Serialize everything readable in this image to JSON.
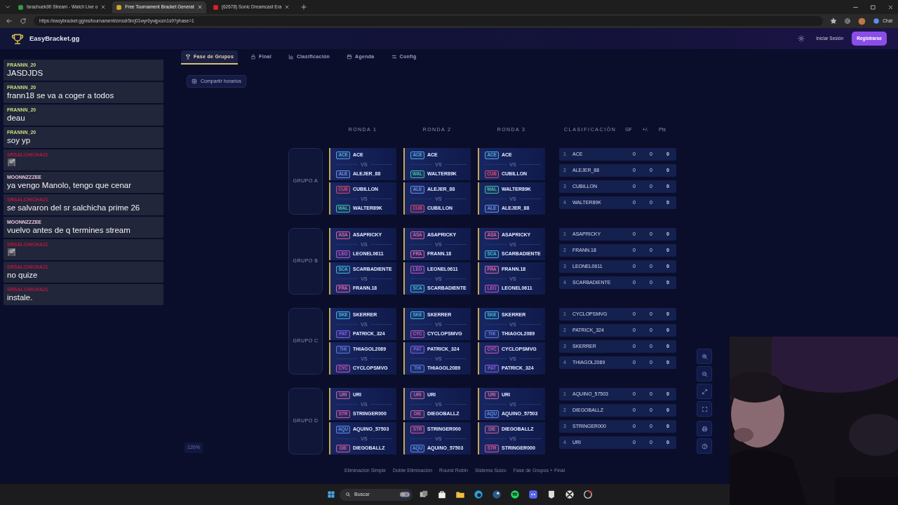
{
  "browser": {
    "tabs": [
      {
        "title": "Israchuek90 Stream - Watch Live o",
        "selected": false
      },
      {
        "title": "Free Tournament Bracket Generat",
        "selected": true
      },
      {
        "title": "(62678) Sonic Dreamcast Era",
        "selected": false
      }
    ],
    "url": "https://easybracket.gg/es/tournament/cmsdr5mj01wyr6ywjpozn1s9?phase=1",
    "chat_button": "Chat"
  },
  "app": {
    "brand": "EasyBracket.gg",
    "login": "Iniciar Sesión",
    "register": "Registrarse"
  },
  "chat": [
    {
      "user": "FRANNN_20",
      "color": "#c9dc82",
      "kind": "text",
      "message": "JASDJDS"
    },
    {
      "user": "FRANNN_20",
      "color": "#c9dc82",
      "kind": "text",
      "message": "frann18 se va a coger a todos"
    },
    {
      "user": "FRANNN_20",
      "color": "#c9dc82",
      "kind": "text",
      "message": "deau"
    },
    {
      "user": "FRANNN_20",
      "color": "#c9dc82",
      "kind": "text",
      "message": "soy yp"
    },
    {
      "user": "SRSALCHICHA21",
      "color": "#b8163e",
      "kind": "emote"
    },
    {
      "user": "MOONNZZZEE",
      "color": "#e8c6de",
      "kind": "text",
      "message": "ya vengo Manolo, tengo que cenar"
    },
    {
      "user": "SRSALCHICHA21",
      "color": "#b8163e",
      "kind": "text",
      "message": "se salvaron del sr salchicha prime 26"
    },
    {
      "user": "MOONNZZZEE",
      "color": "#e8c6de",
      "kind": "text",
      "message": "vuelvo antes de q termines stream"
    },
    {
      "user": "SRSALCHICHA21",
      "color": "#b8163e",
      "kind": "emote"
    },
    {
      "user": "SRSALCHICHA21",
      "color": "#b8163e",
      "kind": "text",
      "message": "no quize"
    },
    {
      "user": "SRSALCHICHA21",
      "color": "#b8163e",
      "kind": "text",
      "message": "instale."
    }
  ],
  "tabs": [
    {
      "label": "Fase de Grupos",
      "selected": true
    },
    {
      "label": "Final",
      "selected": false
    },
    {
      "label": "Clasificación",
      "selected": false
    },
    {
      "label": "Agenda",
      "selected": false
    },
    {
      "label": "Config",
      "selected": false
    }
  ],
  "share_button": "Compartir horarios",
  "round_headers": [
    "RONDA 1",
    "RONDA 2",
    "RONDA 3"
  ],
  "standings_headers": [
    "CLASIFICACIÓN",
    "GF",
    "+/-",
    "Pts"
  ],
  "groups": [
    {
      "label": "GRUPO A",
      "rounds": [
        [
          {
            "a": {
              "tag": "ACE",
              "name": "ACE",
              "color": "#4aa8e8"
            },
            "vs": "VS",
            "b": {
              "tag": "ALE",
              "name": "ALEJER_88",
              "color": "#6a8ee8"
            }
          },
          {
            "a": {
              "tag": "CUB",
              "name": "CUBILLON",
              "color": "#e0406a"
            },
            "vs": "VS",
            "b": {
              "tag": "WAL",
              "name": "WALTER89K",
              "color": "#3cc0a0"
            }
          }
        ],
        [
          {
            "a": {
              "tag": "ACE",
              "name": "ACE",
              "color": "#4aa8e8"
            },
            "vs": "VS",
            "b": {
              "tag": "WAL",
              "name": "WALTER89K",
              "color": "#3cc0a0"
            }
          },
          {
            "a": {
              "tag": "ALE",
              "name": "ALEJER_88",
              "color": "#6a8ee8"
            },
            "vs": "VS",
            "b": {
              "tag": "CUB",
              "name": "CUBILLON",
              "color": "#e0406a"
            }
          }
        ],
        [
          {
            "a": {
              "tag": "ACE",
              "name": "ACE",
              "color": "#4aa8e8"
            },
            "vs": "VS",
            "b": {
              "tag": "CUB",
              "name": "CUBILLON",
              "color": "#e0406a"
            }
          },
          {
            "a": {
              "tag": "WAL",
              "name": "WALTER89K",
              "color": "#3cc0a0"
            },
            "vs": "VS",
            "b": {
              "tag": "ALE",
              "name": "ALEJER_88",
              "color": "#6a8ee8"
            }
          }
        ]
      ],
      "standings": [
        {
          "rank": "1",
          "name": "ACE",
          "gf": "0",
          "diff": "0",
          "pts": "0"
        },
        {
          "rank": "2",
          "name": "ALEJER_88",
          "gf": "0",
          "diff": "0",
          "pts": "0"
        },
        {
          "rank": "3",
          "name": "CUBILLON",
          "gf": "0",
          "diff": "0",
          "pts": "0"
        },
        {
          "rank": "4",
          "name": "WALTER89K",
          "gf": "0",
          "diff": "0",
          "pts": "0"
        }
      ]
    },
    {
      "label": "GRUPO B",
      "rounds": [
        [
          {
            "a": {
              "tag": "ASA",
              "name": "ASAPRICKY",
              "color": "#e05a9a"
            },
            "vs": "VS",
            "b": {
              "tag": "LEO",
              "name": "LEONEL0611",
              "color": "#c050c8"
            }
          },
          {
            "a": {
              "tag": "SCA",
              "name": "SCARBADIENTE",
              "color": "#3ab8d8"
            },
            "vs": "VS",
            "b": {
              "tag": "FRA",
              "name": "FRANN.18",
              "color": "#e060a8"
            }
          }
        ],
        [
          {
            "a": {
              "tag": "ASA",
              "name": "ASAPRICKY",
              "color": "#e05a9a"
            },
            "vs": "VS",
            "b": {
              "tag": "FRA",
              "name": "FRANN.18",
              "color": "#e060a8"
            }
          },
          {
            "a": {
              "tag": "LEO",
              "name": "LEONEL0611",
              "color": "#c050c8"
            },
            "vs": "VS",
            "b": {
              "tag": "SCA",
              "name": "SCARBADIENTE",
              "color": "#3ab8d8"
            }
          }
        ],
        [
          {
            "a": {
              "tag": "ASA",
              "name": "ASAPRICKY",
              "color": "#e05a9a"
            },
            "vs": "VS",
            "b": {
              "tag": "SCA",
              "name": "SCARBADIENTE",
              "color": "#3ab8d8"
            }
          },
          {
            "a": {
              "tag": "FRA",
              "name": "FRANN.18",
              "color": "#e060a8"
            },
            "vs": "VS",
            "b": {
              "tag": "LEO",
              "name": "LEONEL0611",
              "color": "#c050c8"
            }
          }
        ]
      ],
      "standings": [
        {
          "rank": "1",
          "name": "ASAPRICKY",
          "gf": "0",
          "diff": "0",
          "pts": "0"
        },
        {
          "rank": "2",
          "name": "FRANN.18",
          "gf": "0",
          "diff": "0",
          "pts": "0"
        },
        {
          "rank": "3",
          "name": "LEONEL0611",
          "gf": "0",
          "diff": "0",
          "pts": "0"
        },
        {
          "rank": "4",
          "name": "SCARBADIENTE",
          "gf": "0",
          "diff": "0",
          "pts": "0"
        }
      ]
    },
    {
      "label": "GRUPO C",
      "rounds": [
        [
          {
            "a": {
              "tag": "SKE",
              "name": "SKERRER",
              "color": "#3ab8e8"
            },
            "vs": "VS",
            "b": {
              "tag": "PAT",
              "name": "PATRICK_324",
              "color": "#8a5ae8"
            }
          },
          {
            "a": {
              "tag": "THI",
              "name": "THIAGOL2089",
              "color": "#5a7ae8"
            },
            "vs": "VS",
            "b": {
              "tag": "CYC",
              "name": "CYCLOPSMVG",
              "color": "#d050c0"
            }
          }
        ],
        [
          {
            "a": {
              "tag": "SKE",
              "name": "SKERRER",
              "color": "#3ab8e8"
            },
            "vs": "VS",
            "b": {
              "tag": "CYC",
              "name": "CYCLOPSMVG",
              "color": "#d050c0"
            }
          },
          {
            "a": {
              "tag": "PAT",
              "name": "PATRICK_324",
              "color": "#8a5ae8"
            },
            "vs": "VS",
            "b": {
              "tag": "THI",
              "name": "THIAGOL2089",
              "color": "#5a7ae8"
            }
          }
        ],
        [
          {
            "a": {
              "tag": "SKE",
              "name": "SKERRER",
              "color": "#3ab8e8"
            },
            "vs": "VS",
            "b": {
              "tag": "THI",
              "name": "THIAGOL2089",
              "color": "#5a7ae8"
            }
          },
          {
            "a": {
              "tag": "CYC",
              "name": "CYCLOPSMVG",
              "color": "#d050c0"
            },
            "vs": "VS",
            "b": {
              "tag": "PAT",
              "name": "PATRICK_324",
              "color": "#8a5ae8"
            }
          }
        ]
      ],
      "standings": [
        {
          "rank": "1",
          "name": "CYCLOPSMVG",
          "gf": "0",
          "diff": "0",
          "pts": "0"
        },
        {
          "rank": "2",
          "name": "PATRICK_324",
          "gf": "0",
          "diff": "0",
          "pts": "0"
        },
        {
          "rank": "3",
          "name": "SKERRER",
          "gf": "0",
          "diff": "0",
          "pts": "0"
        },
        {
          "rank": "4",
          "name": "THIAGOL2089",
          "gf": "0",
          "diff": "0",
          "pts": "0"
        }
      ]
    },
    {
      "label": "GRUPO D",
      "rounds": [
        [
          {
            "a": {
              "tag": "URI",
              "name": "URI",
              "color": "#d060a0"
            },
            "vs": "VS",
            "b": {
              "tag": "STR",
              "name": "STRINGER000",
              "color": "#e0509a"
            }
          },
          {
            "a": {
              "tag": "AQU",
              "name": "AQUINO_57503",
              "color": "#5a8ae8"
            },
            "vs": "VS",
            "b": {
              "tag": "DIE",
              "name": "DIEGOBALLZ",
              "color": "#d05a9a"
            }
          }
        ],
        [
          {
            "a": {
              "tag": "URI",
              "name": "URI",
              "color": "#d060a0"
            },
            "vs": "VS",
            "b": {
              "tag": "DIE",
              "name": "DIEGOBALLZ",
              "color": "#d05a9a"
            }
          },
          {
            "a": {
              "tag": "STR",
              "name": "STRINGER000",
              "color": "#e0509a"
            },
            "vs": "VS",
            "b": {
              "tag": "AQU",
              "name": "AQUINO_57503",
              "color": "#5a8ae8"
            }
          }
        ],
        [
          {
            "a": {
              "tag": "URI",
              "name": "URI",
              "color": "#d060a0"
            },
            "vs": "VS",
            "b": {
              "tag": "AQU",
              "name": "AQUINO_57503",
              "color": "#5a8ae8"
            }
          },
          {
            "a": {
              "tag": "DIE",
              "name": "DIEGOBALLZ",
              "color": "#d05a9a"
            },
            "vs": "VS",
            "b": {
              "tag": "STR",
              "name": "STRINGER000",
              "color": "#e0509a"
            }
          }
        ]
      ],
      "standings": [
        {
          "rank": "1",
          "name": "AQUINO_57503",
          "gf": "0",
          "diff": "0",
          "pts": "0"
        },
        {
          "rank": "2",
          "name": "DIEGOBALLZ",
          "gf": "0",
          "diff": "0",
          "pts": "0"
        },
        {
          "rank": "3",
          "name": "STRINGER000",
          "gf": "0",
          "diff": "0",
          "pts": "0"
        },
        {
          "rank": "4",
          "name": "URI",
          "gf": "0",
          "diff": "0",
          "pts": "0"
        }
      ]
    }
  ],
  "zoom_level": "120%",
  "footer_links": [
    "Eliminación Simple",
    "Doble Eliminación",
    "Round Robin",
    "Sistema Suizo",
    "Fase de Grupos + Final"
  ],
  "taskbar": {
    "search_placeholder": "Buscar"
  },
  "webcam": {
    "kind": "picture"
  }
}
